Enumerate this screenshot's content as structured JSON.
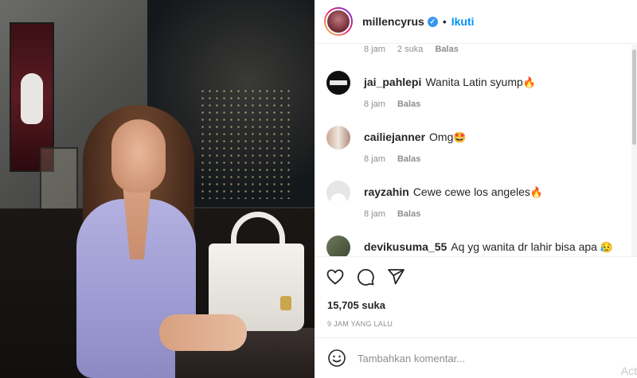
{
  "post": {
    "username": "millencyrus",
    "follow_label": "Ikuti",
    "separator": "•",
    "verified_mark": "✓"
  },
  "comments": [
    {
      "user": "",
      "text": "",
      "meta_time": "8 jam",
      "meta_likes": "2 suka",
      "reply_label": "Balas"
    },
    {
      "user": "jai_pahlepi",
      "text": "Wanita Latin syump",
      "emoji": "🔥",
      "meta_time": "8 jam",
      "reply_label": "Balas"
    },
    {
      "user": "cailiejanner",
      "text": "Omg",
      "emoji": "🤩",
      "meta_time": "8 jam",
      "reply_label": "Balas"
    },
    {
      "user": "rayzahin",
      "text": "Cewe cewe los angeles",
      "emoji": "🔥",
      "meta_time": "8 jam",
      "reply_label": "Balas"
    },
    {
      "user": "devikusuma_55",
      "text": "Aq yg wanita dr lahir bisa apa",
      "emoji": "😥"
    }
  ],
  "engagement": {
    "likes": "15,705 suka",
    "posted": "9 JAM YANG LALU"
  },
  "comment_box": {
    "placeholder": "Tambahkan komentar..."
  },
  "watermark": "Act",
  "icons": {
    "like": "heart-icon",
    "comment": "comment-icon",
    "share": "share-icon",
    "emoji": "emoji-icon",
    "verified": "verified-badge-icon"
  },
  "colors": {
    "link_blue": "#0095f6",
    "verified_blue": "#3897f0",
    "muted": "#8e8e8e",
    "text": "#262626"
  }
}
